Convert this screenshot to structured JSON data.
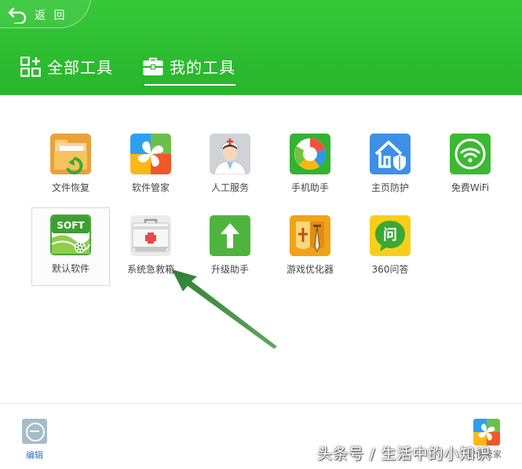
{
  "header": {
    "back_label": "返 回",
    "tabs": [
      {
        "label": "全部工具",
        "icon": "grid-plus-icon",
        "active": false
      },
      {
        "label": "我的工具",
        "icon": "toolbox-icon",
        "active": true
      }
    ]
  },
  "tools": {
    "row1": [
      {
        "label": "文件恢复",
        "icon": "folder-restore-icon"
      },
      {
        "label": "软件管家",
        "icon": "software-manager-icon"
      },
      {
        "label": "人工服务",
        "icon": "doctor-service-icon"
      },
      {
        "label": "手机助手",
        "icon": "phone-assistant-icon"
      },
      {
        "label": "主页防护",
        "icon": "homepage-shield-icon"
      },
      {
        "label": "免费WiFi",
        "icon": "wifi-icon"
      }
    ],
    "row2": [
      {
        "label": "默认软件",
        "icon": "default-software-icon",
        "badge": "SOFT",
        "selected": true
      },
      {
        "label": "系统急救箱",
        "icon": "first-aid-kit-icon"
      },
      {
        "label": "升级助手",
        "icon": "upgrade-arrow-icon"
      },
      {
        "label": "游戏优化器",
        "icon": "game-optimizer-icon"
      },
      {
        "label": "360问答",
        "icon": "qa-chat-icon",
        "glyph": "问"
      }
    ]
  },
  "footer": {
    "edit_label": "编辑",
    "manager_label_partial": "软件管家"
  },
  "watermark": "头条号 / 生活中的小知识",
  "colors": {
    "header_green": "#2dbd31",
    "annotation_arrow": "#3c8a3c",
    "link_blue": "#2b75c9"
  }
}
